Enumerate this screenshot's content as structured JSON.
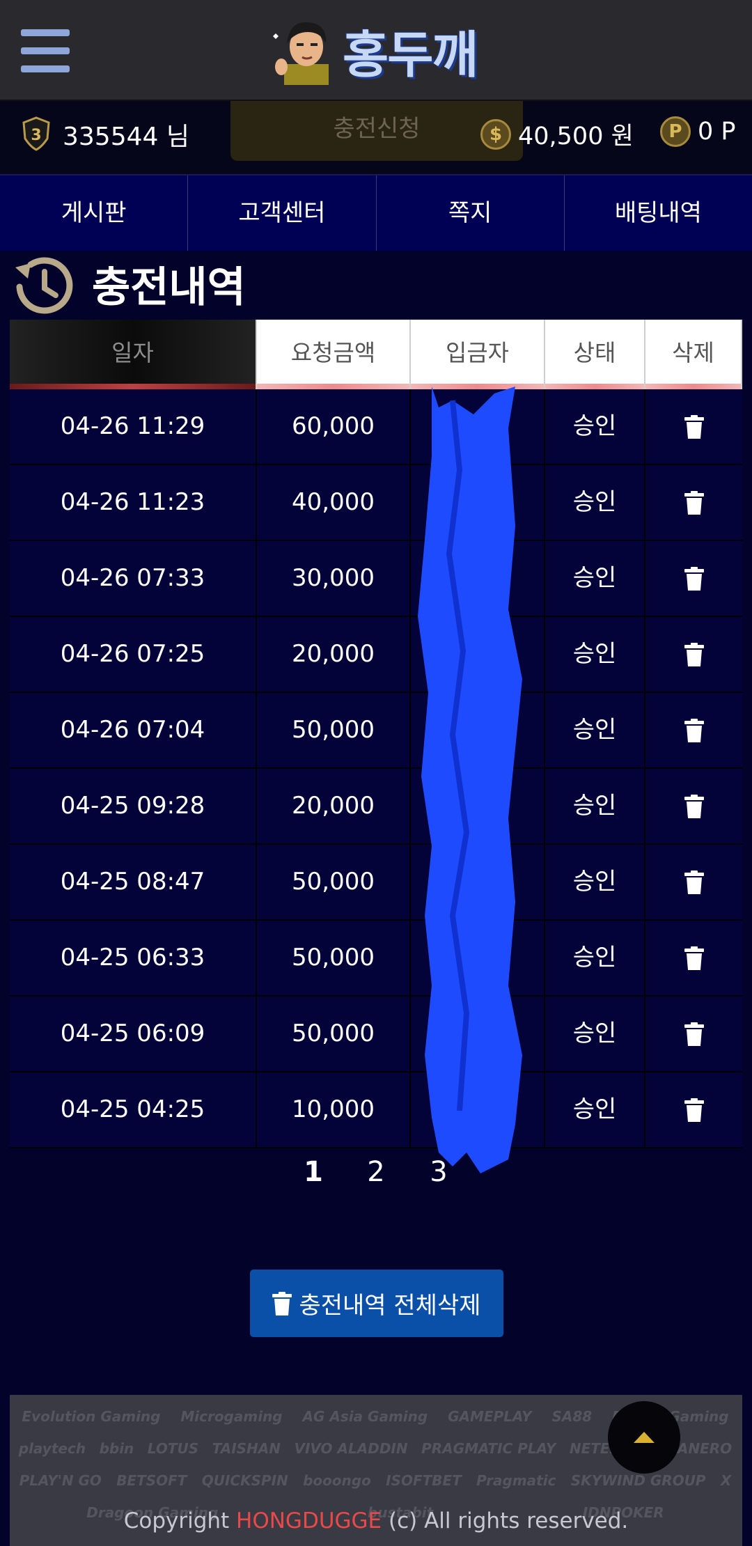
{
  "header": {
    "logo_text": "홍두깨"
  },
  "userbar": {
    "level": "3",
    "username": "335544 님",
    "charge_button": "충전신청",
    "money": "40,500 원",
    "money_icon": "$",
    "points": "0 P",
    "points_icon": "P"
  },
  "nav": {
    "items": [
      {
        "label": "게시판"
      },
      {
        "label": "고객센터"
      },
      {
        "label": "쪽지"
      },
      {
        "label": "배팅내역"
      }
    ]
  },
  "page": {
    "title": "충전내역"
  },
  "table": {
    "headers": [
      "일자",
      "요청금액",
      "입금자",
      "상태",
      "삭제"
    ],
    "rows": [
      {
        "date": "04-26 11:29",
        "amount": "60,000",
        "depositor": "",
        "status": "승인"
      },
      {
        "date": "04-26 11:23",
        "amount": "40,000",
        "depositor": "",
        "status": "승인"
      },
      {
        "date": "04-26 07:33",
        "amount": "30,000",
        "depositor": "",
        "status": "승인"
      },
      {
        "date": "04-26 07:25",
        "amount": "20,000",
        "depositor": "",
        "status": "승인"
      },
      {
        "date": "04-26 07:04",
        "amount": "50,000",
        "depositor": "",
        "status": "승인"
      },
      {
        "date": "04-25 09:28",
        "amount": "20,000",
        "depositor": "",
        "status": "승인"
      },
      {
        "date": "04-25 08:47",
        "amount": "50,000",
        "depositor": "",
        "status": "승인"
      },
      {
        "date": "04-25 06:33",
        "amount": "50,000",
        "depositor": "",
        "status": "승인"
      },
      {
        "date": "04-25 06:09",
        "amount": "50,000",
        "depositor": "",
        "status": "승인"
      },
      {
        "date": "04-25 04:25",
        "amount": "10,000",
        "depositor": "",
        "status": "승인"
      }
    ]
  },
  "pagination": {
    "pages": [
      "1",
      "2",
      "3"
    ],
    "current": "1"
  },
  "delete_all_button": "충전내역 전체삭제",
  "footer": {
    "providers": [
      "Evolution Gaming",
      "Microgaming",
      "AG Asia Gaming",
      "GAMEPLAY",
      "SA88",
      "Dream Gaming",
      "playtech",
      "bbin",
      "LOTUS",
      "TAISHAN",
      "VIVO ALADDIN",
      "PRAGMATIC PLAY",
      "NETENT",
      "HABANERO",
      "PLAY'N GO",
      "BETSOFT",
      "QUICKSPIN",
      "booongo",
      "ISOFTBET",
      "Pragmatic",
      "SKYWIND GROUP",
      "X",
      "Dragoon Gaming",
      "bustabit",
      "IDNPOKER"
    ],
    "copyright_prefix": "Copyright ",
    "copyright_brand": "HONGDUGGE",
    "copyright_suffix": " (c) All rights reserved."
  },
  "colors": {
    "nav_bg": "#000055",
    "table_bg": "#03033a",
    "button_bg": "#0a4fa8",
    "brand_red": "#e84a4a",
    "redaction": "#1f4bff"
  }
}
